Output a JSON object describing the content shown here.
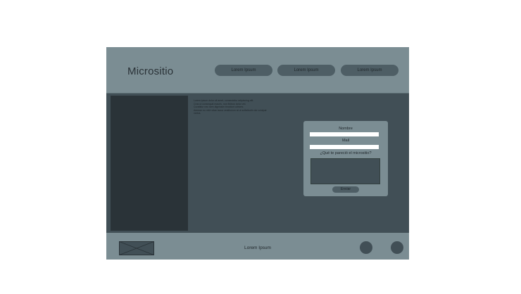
{
  "header": {
    "title": "Micrositio",
    "nav": [
      "Lorem Ipsum",
      "Lorem Ipsum",
      "Lorem Ipsum"
    ]
  },
  "main": {
    "paragraphs": [
      "Lorem ipsum dolor sit amet, consectetur adipiscing elit.",
      "Cras ut consequat mauris, non finibus tortor vel.",
      "Curabitur nec sem dignissim tincidunt ultrices.",
      "Aenean eu nibh vitae lacus vestibulum at ut sollicitudin dui volutpat",
      "varius."
    ]
  },
  "form": {
    "name_label": "Nombre",
    "mail_label": "Mail",
    "question_label": "¿Qué te pareció el micrositio?",
    "submit_label": "Enviar"
  },
  "footer": {
    "text": "Lorem Ipsum"
  },
  "colors": {
    "page_bg": "#ffffff",
    "header_bg": "#7b8d93",
    "body_bg": "#414f56",
    "sidebar_bg": "#2a3338",
    "button_bg": "#4e5e65"
  }
}
